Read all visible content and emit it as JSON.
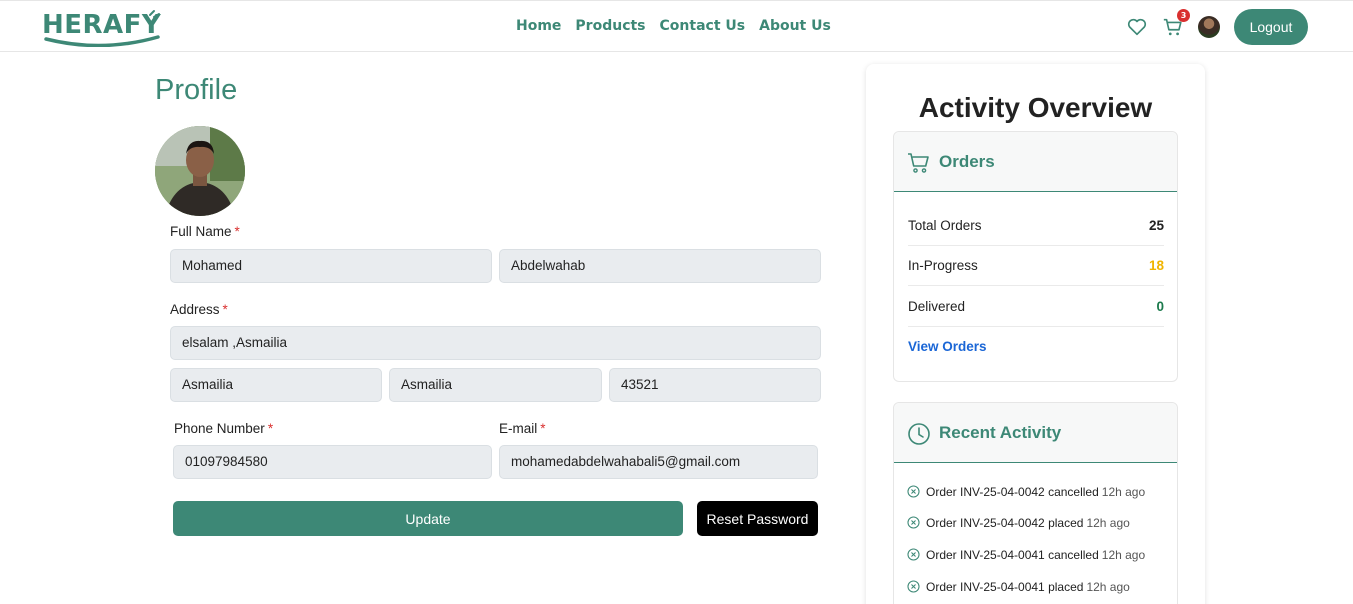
{
  "nav": {
    "logo_text": "HERAFY",
    "links": [
      "Home",
      "Products",
      "Contact Us",
      "About Us"
    ],
    "cart_count": "3",
    "logout_label": "Logout"
  },
  "profile": {
    "title": "Profile",
    "full_name_label": "Full Name",
    "first_name": "Mohamed",
    "last_name": "Abdelwahab",
    "address_label": "Address",
    "street": "elsalam ,Asmailia",
    "city": "Asmailia",
    "state": "Asmailia",
    "zip": "43521",
    "phone_label": "Phone Number",
    "phone": "01097984580",
    "email_label": "E-mail",
    "email": "mohamedabdelwahabali5@gmail.com",
    "required_mark": "*",
    "update_label": "Update",
    "reset_label": "Reset Password"
  },
  "overview": {
    "title": "Activity Overview",
    "orders_title": "Orders",
    "stats": [
      {
        "label": "Total Orders",
        "value": "25",
        "color": "#222222"
      },
      {
        "label": "In-Progress",
        "value": "18",
        "color": "#f0b400"
      },
      {
        "label": "Delivered",
        "value": "0",
        "color": "#1c7a4c"
      }
    ],
    "view_orders_label": "View Orders",
    "recent_title": "Recent Activity",
    "activities": [
      {
        "text": "Order INV-25-04-0042 cancelled",
        "time": "12h ago"
      },
      {
        "text": "Order INV-25-04-0042 placed",
        "time": "12h ago"
      },
      {
        "text": "Order INV-25-04-0041 cancelled",
        "time": "12h ago"
      },
      {
        "text": "Order INV-25-04-0041 placed",
        "time": "12h ago"
      }
    ]
  },
  "colors": {
    "brand": "#3d8876",
    "danger": "#d9302f",
    "link": "#1a66d6"
  },
  "icons": [
    "heart-icon",
    "cart-icon",
    "clock-icon",
    "x-circle-icon"
  ]
}
